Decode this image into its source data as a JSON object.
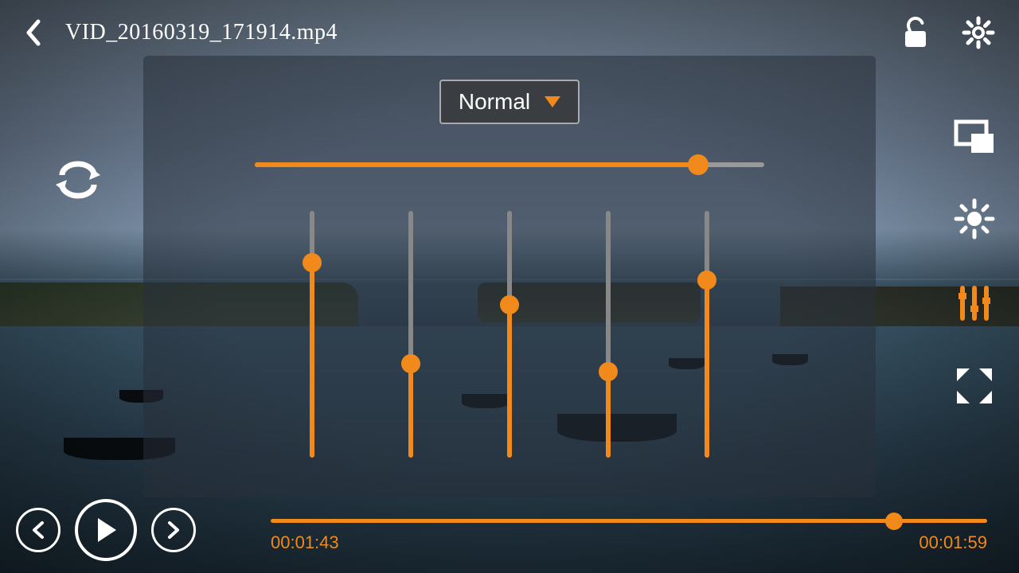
{
  "header": {
    "filename": "VID_20160319_171914.mp4"
  },
  "eq": {
    "preset": "Normal",
    "gain_percent": 87,
    "bands": [
      {
        "percent": 79
      },
      {
        "percent": 38
      },
      {
        "percent": 62
      },
      {
        "percent": 35
      },
      {
        "percent": 72
      }
    ]
  },
  "playback": {
    "current_time": "00:01:43",
    "duration": "00:01:59",
    "seek_percent": 87
  },
  "colors": {
    "accent": "#f18a1a",
    "icon": "#ffffff"
  },
  "icons": {
    "back": "back-icon",
    "lock": "unlock-icon",
    "settings": "gear-icon",
    "loop": "loop-icon",
    "pip": "pip-icon",
    "brightness": "brightness-icon",
    "equalizer": "equalizer-icon",
    "fullscreen": "expand-icon",
    "prev": "prev-icon",
    "play": "play-icon",
    "next": "next-icon"
  }
}
